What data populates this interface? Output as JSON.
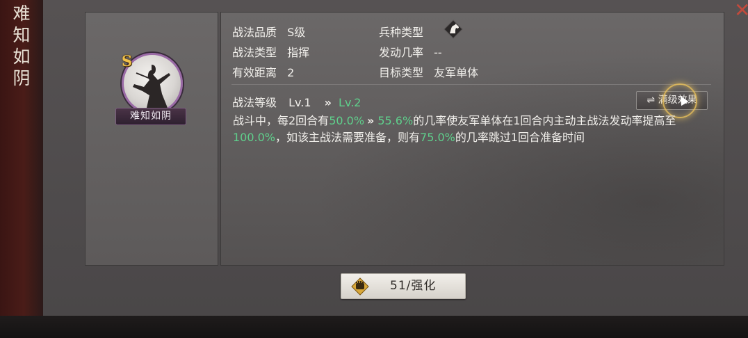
{
  "tactic": {
    "name_vertical": [
      "难",
      "知",
      "如",
      "阴"
    ],
    "grade_badge": "S",
    "name_plate": "难知如阴"
  },
  "attributes": {
    "quality_label": "战法品质",
    "quality_value": "S级",
    "type_label": "战法类型",
    "type_value": "指挥",
    "range_label": "有效距离",
    "range_value": "2",
    "troop_label": "兵种类型",
    "rate_label": "发动几率",
    "rate_value": "--",
    "target_label": "目标类型",
    "target_value": "友军单体"
  },
  "level": {
    "label": "战法等级",
    "current": "Lv.1",
    "arrow": "»",
    "next": "Lv.2",
    "full_effect_button": "⇌ 满级效果"
  },
  "description": {
    "p1": "战斗中，每2回合有",
    "v1": "50.0%",
    "arrow": "»",
    "v2": "55.6%",
    "p2": "的几率使友军单体在1回合内主动主战法发动率提高至",
    "v3": "100.0%",
    "p3": "，如该主战法需要准备，则有",
    "v4": "75.0%",
    "p4": "的几率跳过1回合准备时间"
  },
  "enhance": {
    "label": "51/强化"
  },
  "icons": {
    "troop_type": "horse-head-icon",
    "enhance": "fist-icon",
    "close": "close-icon"
  },
  "colors": {
    "highlight_green": "#5fd08c",
    "grade_gold": "#f1c14a",
    "close_red": "#c14a3c"
  }
}
